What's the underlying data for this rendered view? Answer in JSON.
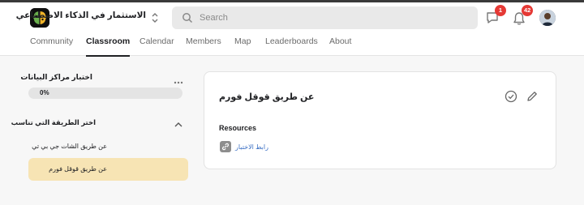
{
  "header": {
    "group_name": "الاستثمار في الذكاء الاصطناعي",
    "search_placeholder": "Search",
    "chat_badge": "1",
    "notifications_badge": "42",
    "icons": {
      "logo": "brain-logo-icon",
      "switcher": "chevron-updown-icon",
      "search": "search-icon",
      "chat": "chat-icon",
      "notifications": "bell-icon",
      "avatar": "user-avatar"
    }
  },
  "nav": {
    "tabs": [
      {
        "label": "Community",
        "active": false
      },
      {
        "label": "Classroom",
        "active": true
      },
      {
        "label": "Calendar",
        "active": false
      },
      {
        "label": "Members",
        "active": false
      },
      {
        "label": "Map",
        "active": false
      },
      {
        "label": "Leaderboards",
        "active": false
      },
      {
        "label": "About",
        "active": false
      }
    ]
  },
  "sidebar": {
    "course_title": "اختبار مراكز البيانات",
    "more_icon": "more-dots-icon",
    "progress_label": "0%",
    "progress_value": 0,
    "section_title": "اختر الطريقة التي تناسب",
    "collapse_icon": "chevron-up-icon",
    "lessons": [
      {
        "label": "عن طريق الشات جي بي تي",
        "active": false
      },
      {
        "label": "عن طريق قوقل فورم",
        "active": true
      }
    ]
  },
  "content": {
    "title": "عن طريق قوقل فورم",
    "check_icon": "check-circle-icon",
    "edit_icon": "pencil-icon",
    "resources_label": "Resources",
    "resource_link_icon": "link-icon",
    "resource_link": "رابط الاختبار"
  },
  "colors": {
    "active_lesson_bg": "#f7e4b4",
    "badge": "#e53935",
    "link": "#3a6fc4",
    "page_bg": "#f7f7f7"
  }
}
